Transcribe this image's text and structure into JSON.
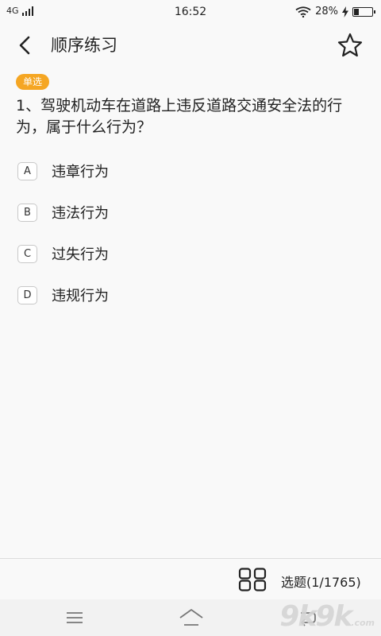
{
  "status_bar": {
    "network": "4G",
    "time": "16:52",
    "battery_percent": "28%",
    "battery_level": 0.28,
    "icons": [
      "signal-icon",
      "wifi-icon",
      "charging-icon",
      "battery-icon"
    ]
  },
  "header": {
    "title": "顺序练习",
    "icons": [
      "back-arrow-icon",
      "star-icon"
    ]
  },
  "question": {
    "type_badge": "单选",
    "text": "1、驾驶机动车在道路上违反道路交通安全法的行为，属于什么行为？",
    "options": [
      {
        "letter": "A",
        "text": "违章行为"
      },
      {
        "letter": "B",
        "text": "违法行为"
      },
      {
        "letter": "C",
        "text": "过失行为"
      },
      {
        "letter": "D",
        "text": "违规行为"
      }
    ]
  },
  "bottom_bar": {
    "progress_label": "选题(1/1765)",
    "icons": [
      "grid-icon"
    ]
  },
  "nav_bar": {
    "icons": [
      "menu-icon",
      "home-icon",
      "back-icon"
    ]
  },
  "watermark": {
    "text": "9k9k",
    "suffix": ".com"
  },
  "colors": {
    "badge": "#f5a623",
    "background": "#f9f9f9"
  }
}
